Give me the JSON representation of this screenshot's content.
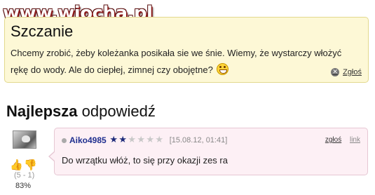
{
  "watermark": {
    "text": "www.wiocha.pl"
  },
  "question": {
    "title": "Szczanie",
    "body_line1": "Chcemy zrobić, żeby koleżanka posikała sie we śnie. Wiemy, że wystarczy włożyć",
    "body_line2": "rękę do wody. Ale do ciepłej, zimnej czy obojętne?",
    "emoticon": "laughing-smiley-icon",
    "report_label": "Zgłoś"
  },
  "best_answer": {
    "heading_bold": "Najlepsza",
    "heading_rest": "odpowiedź",
    "votes": {
      "count_text": "(5 - 1)",
      "percent_text": "83%",
      "up": 5,
      "down": 1,
      "percent": 83
    },
    "answer": {
      "username": "Aiko4985",
      "rating_stars": {
        "filled": 2,
        "total": 6
      },
      "timestamp": "[15.08.12, 01:41]",
      "report_label": "zgłoś",
      "link_label": "link",
      "text": "Do wrzątku włóż, to się przy okazji zes ra"
    }
  },
  "colors": {
    "question_bg": "#fdf8d6",
    "answer_bg": "#fdf0f5",
    "username": "#1f2f8f",
    "star_filled": "#1e2b7a",
    "star_empty": "#c8c8c8"
  }
}
